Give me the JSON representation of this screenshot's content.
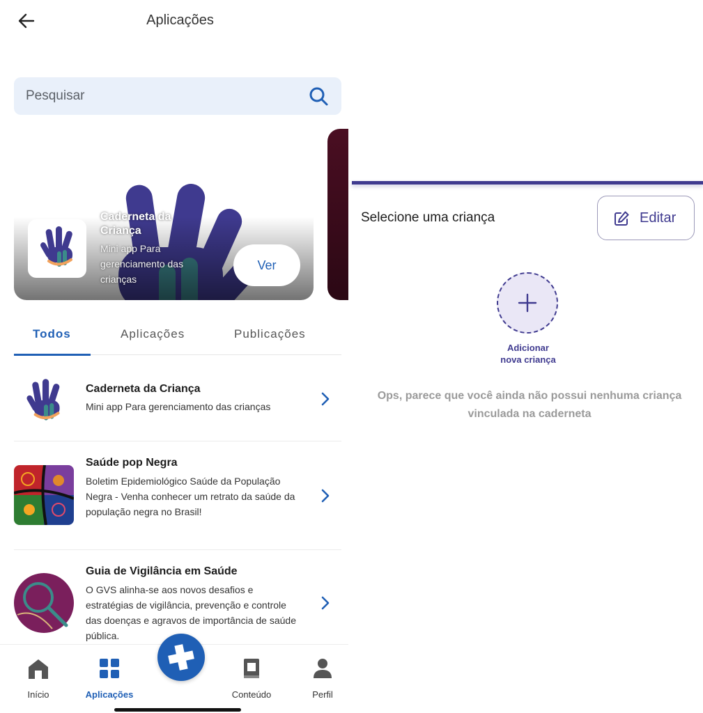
{
  "colors": {
    "primary": "#1f5fb5",
    "accent_purple": "#3f3a8f",
    "search_bg": "#e9f0fa",
    "add_circle_bg": "#eae7f6"
  },
  "header": {
    "back_icon": "arrow-left-icon",
    "title": "Aplicações"
  },
  "search": {
    "placeholder": "Pesquisar",
    "icon": "search-icon"
  },
  "banner": {
    "title": "Caderneta da Criança",
    "description": "Mini app Para gerenciamento das crianças",
    "button_label": "Ver"
  },
  "tabs": [
    {
      "label": "Todos",
      "active": true
    },
    {
      "label": "Aplicações",
      "active": false
    },
    {
      "label": "Publicações",
      "active": false
    }
  ],
  "apps": [
    {
      "title": "Caderneta da Criança",
      "description": "Mini app Para gerenciamento das crianças"
    },
    {
      "title": "Saúde pop Negra",
      "description": "Boletim Epidemiológico Saúde da População Negra - Venha conhecer um retrato da saúde da população negra no Brasil!"
    },
    {
      "title": "Guia de Vigilância em Saúde",
      "description": "O GVS alinha-se aos novos desafios e estratégias de vigilância, prevenção e controle das doenças e agravos de importância de saúde pública."
    }
  ],
  "bottom_nav": [
    {
      "label": "Início",
      "icon": "home-icon",
      "active": false
    },
    {
      "label": "Aplicações",
      "icon": "grid-icon",
      "active": true
    },
    {
      "label": "",
      "icon": "health-cross-icon",
      "active": false
    },
    {
      "label": "Conteúdo",
      "icon": "book-icon",
      "active": false
    },
    {
      "label": "Perfil",
      "icon": "person-icon",
      "active": false
    }
  ],
  "child_panel": {
    "select_label": "Selecione uma criança",
    "edit_label": "Editar",
    "add_label_line1": "Adicionar",
    "add_label_line2": "nova criança",
    "empty_message_line1": "Ops, parece que você ainda não possui nenhuma criança",
    "empty_message_line2": "vinculada na caderneta"
  }
}
